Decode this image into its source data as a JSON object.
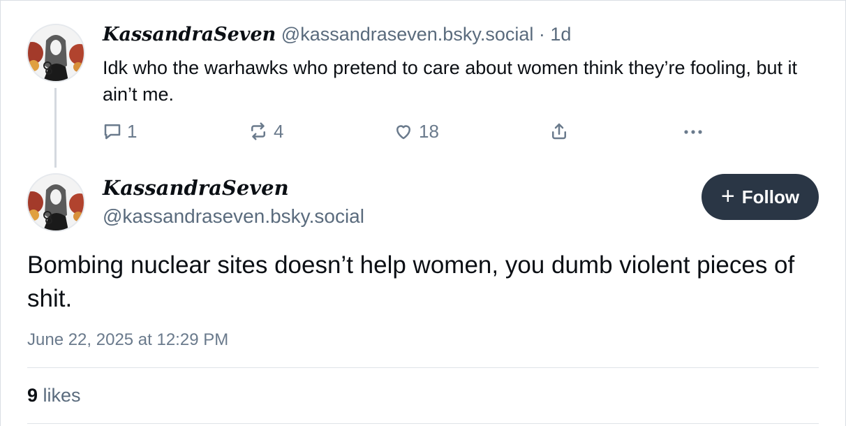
{
  "parent_post": {
    "display_name": "KassandraSeven",
    "handle": "@kassandraseven.bsky.social",
    "separator": "·",
    "relative_time": "1d",
    "text": "Idk who the warhawks who pretend to care about women think they’re fooling, but it ain’t me.",
    "actions": {
      "reply_count": "1",
      "repost_count": "4",
      "like_count": "18"
    }
  },
  "main_post": {
    "display_name": "KassandraSeven",
    "handle": "@kassandraseven.bsky.social",
    "follow_label": "Follow",
    "text": "Bombing nuclear sites doesn’t help women, you dumb violent pieces of shit.",
    "timestamp": "June 22, 2025 at 12:29 PM",
    "likes_count": "9",
    "likes_label": "likes"
  },
  "colors": {
    "follow_button_bg": "#2a3645",
    "muted_text": "#5a6b7d",
    "thread_line": "#d4d9df"
  },
  "icons": [
    "avatar-image",
    "reply-icon",
    "repost-icon",
    "like-icon",
    "share-icon",
    "more-options-icon",
    "plus-icon"
  ]
}
